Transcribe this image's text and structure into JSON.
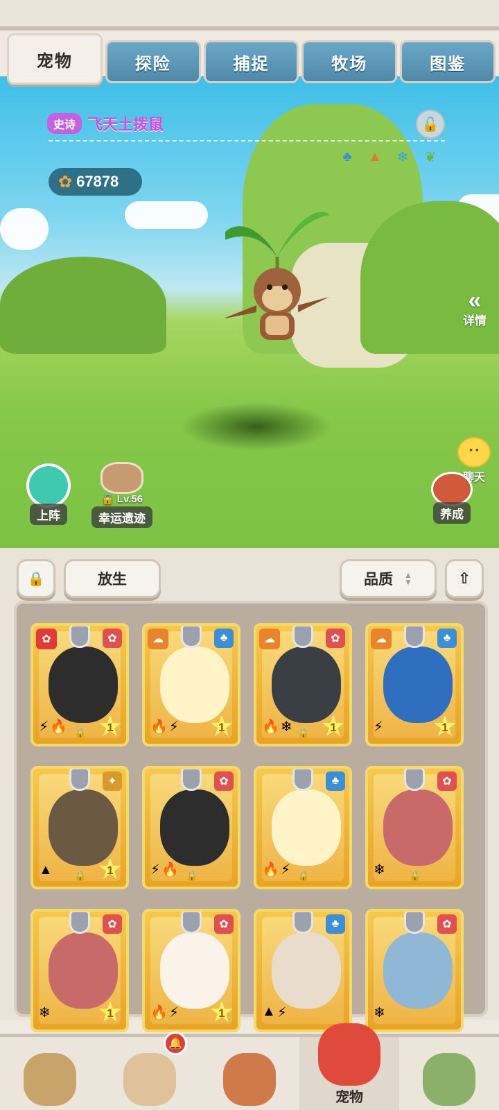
{
  "tabs": [
    {
      "label": "宠物",
      "active": true
    },
    {
      "label": "探险",
      "active": false
    },
    {
      "label": "捕捉",
      "active": false
    },
    {
      "label": "牧场",
      "active": false
    },
    {
      "label": "图鉴",
      "active": false
    }
  ],
  "pet": {
    "quality": "史诗",
    "name": "飞天土拨鼠",
    "attributes": [
      "water-drop-icon",
      "mountain-icon",
      "snowflake-icon",
      "leaf-icon"
    ]
  },
  "currency": {
    "icon": "paw-coin-icon",
    "amount": "67878"
  },
  "side": {
    "detail_label": "详情",
    "chat_label": "聊天"
  },
  "actions": {
    "deploy_label": "上阵",
    "relic_level": "Lv.56",
    "relic_label": "幸运遗迹",
    "nurture_label": "养成"
  },
  "toolbar": {
    "release_label": "放生",
    "sort_label": "品质"
  },
  "cards": [
    {
      "emblem": "red",
      "corner": "paw",
      "elements": [
        "⚡",
        "🔥"
      ],
      "star": "1",
      "creature_color": "#2d2d2d",
      "locked": true
    },
    {
      "emblem": "water",
      "corner": "cloud",
      "elements": [
        "🔥",
        "⚡"
      ],
      "star": "1",
      "creature_color": "#fff4c8",
      "locked": false
    },
    {
      "emblem": "red",
      "corner": "cloud",
      "elements": [
        "🔥",
        "❄"
      ],
      "star": "1",
      "creature_color": "#3a3f46",
      "locked": true
    },
    {
      "emblem": "water",
      "corner": "cloud",
      "elements": [
        "⚡"
      ],
      "star": "1",
      "creature_color": "#2f6fc0",
      "locked": false
    },
    {
      "emblem": "gold",
      "corner": "",
      "elements": [
        "▲"
      ],
      "star": "1",
      "creature_color": "#6a5a44",
      "locked": true
    },
    {
      "emblem": "red",
      "corner": "",
      "elements": [
        "⚡",
        "🔥"
      ],
      "star": "",
      "creature_color": "#2d2d2d",
      "locked": true
    },
    {
      "emblem": "water",
      "corner": "",
      "elements": [
        "🔥",
        "⚡"
      ],
      "star": "",
      "creature_color": "#fff4c8",
      "locked": true
    },
    {
      "emblem": "red",
      "corner": "",
      "elements": [
        "❄"
      ],
      "star": "",
      "creature_color": "#c86a6a",
      "locked": true
    },
    {
      "emblem": "red",
      "corner": "",
      "elements": [
        "❄"
      ],
      "star": "1",
      "creature_color": "#c86a6a",
      "locked": false
    },
    {
      "emblem": "red",
      "corner": "",
      "elements": [
        "🔥",
        "⚡"
      ],
      "star": "1",
      "creature_color": "#fbf3ea",
      "locked": false
    },
    {
      "emblem": "water",
      "corner": "",
      "elements": [
        "▲",
        "⚡"
      ],
      "star": "",
      "creature_color": "#e8dccc",
      "locked": false
    },
    {
      "emblem": "red",
      "corner": "",
      "elements": [
        "❄"
      ],
      "star": "",
      "creature_color": "#8fb7d6",
      "locked": false
    }
  ],
  "nav": [
    {
      "icon": "chief-avatar-icon",
      "label": "",
      "active": false
    },
    {
      "icon": "hero-avatar-icon",
      "label": "",
      "active": false,
      "notify": true
    },
    {
      "icon": "totem-mask-icon",
      "label": "",
      "active": false
    },
    {
      "icon": "red-dino-pet-icon",
      "label": "宠物",
      "active": true
    },
    {
      "icon": "stone-house-icon",
      "label": "",
      "active": false
    }
  ],
  "colors": {
    "accent_tab": "#4f89aa",
    "epic": "#c65fe0",
    "card_gold": "#e9a324"
  }
}
